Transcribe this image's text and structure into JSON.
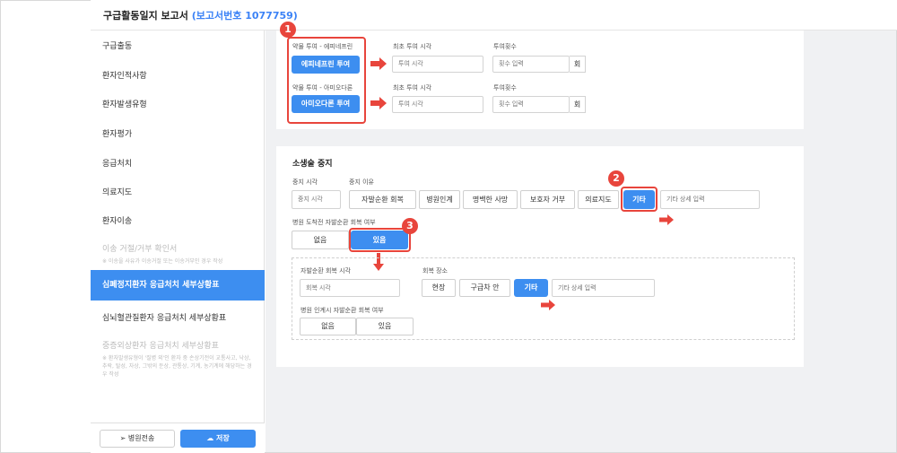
{
  "header": {
    "title": "구급활동일지 보고서",
    "report_no": "(보고서번호 1077759)"
  },
  "sidebar": {
    "items": [
      {
        "label": "구급출동"
      },
      {
        "label": "환자인적사항"
      },
      {
        "label": "환자발생유형"
      },
      {
        "label": "환자평가"
      },
      {
        "label": "응급처치"
      },
      {
        "label": "의료지도"
      },
      {
        "label": "환자이송"
      },
      {
        "label": "이송 거절/거부 확인서",
        "sub": "※ 이송을 사유가 이송거절 또는 이송거부인 경우 작성"
      },
      {
        "label": "심폐정지환자 응급처치 세부상황표"
      },
      {
        "label": "심뇌혈관질환자 응급처치 세부상황표"
      },
      {
        "label": "중증외상환자 응급처치 세부상황표",
        "sub": "※ 환자발생유형이 '질병 외'인 환자 중 손상기전이 교통사고, 낙상, 추락, 탈성, 자상, 그밖의 둔상, 관통상, 기계, 농기계에 해당하는 경우 작성"
      }
    ],
    "footer": {
      "transfer": "병원전송",
      "save": "저장"
    }
  },
  "drug": {
    "epi": {
      "label": "약물 투여 - 에피네프린",
      "button": "에피네프린 투여",
      "time_label": "최초 투여 시각",
      "time_placeholder": "투여 시각",
      "count_label": "투여횟수",
      "count_placeholder": "횟수 입력",
      "unit": "회"
    },
    "amio": {
      "label": "약물 투여 - 아미오다론",
      "button": "아미오다론 투여",
      "time_label": "최초 투여 시각",
      "time_placeholder": "투여 시각",
      "count_label": "투여횟수",
      "count_placeholder": "횟수 입력",
      "unit": "회"
    }
  },
  "cpr_stop": {
    "title": "소생술 중지",
    "stop_time_label": "중지 시각",
    "stop_time_placeholder": "중지 시각",
    "reason_label": "중지 이유",
    "reasons": [
      "자발순환 회복",
      "병원인계",
      "명백한 사망",
      "보호자 거부",
      "의료지도",
      "기타"
    ],
    "reason_detail_placeholder": "기타 상세 입력",
    "rosc_question": "병원 도착전 자발순환 회복 여부",
    "rosc_options": [
      "없음",
      "있음"
    ],
    "rosc_time_label": "자발순환 회복 시각",
    "rosc_time_placeholder": "회복 시각",
    "rosc_place_label": "회복 장소",
    "rosc_places": [
      "현장",
      "구급차 안",
      "기타"
    ],
    "rosc_place_detail_placeholder": "기타 상세 입력",
    "handover_question": "병원 인계시 자발순환 회복 여부",
    "handover_options": [
      "없음",
      "있음"
    ]
  },
  "annotations": [
    "1",
    "2",
    "3"
  ],
  "colors": {
    "accent": "#3d8ef0",
    "highlight": "#e8453c"
  }
}
